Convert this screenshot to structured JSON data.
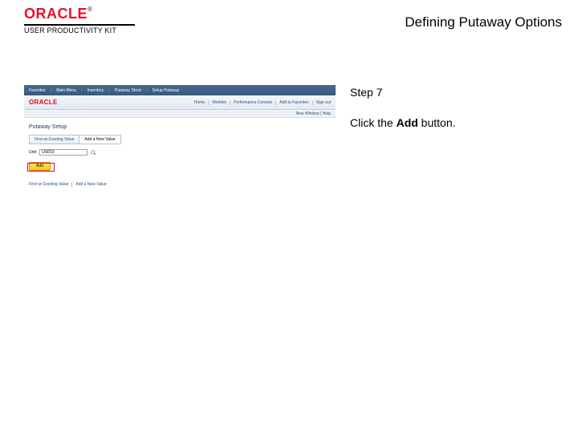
{
  "header": {
    "brand": "ORACLE",
    "brand_suffix": "®",
    "subtitle": "USER PRODUCTIVITY KIT",
    "slide_title": "Defining Putaway Options"
  },
  "instruction": {
    "step_label": "Step 7",
    "text_before": "Click the ",
    "bold": "Add",
    "text_after": " button."
  },
  "app": {
    "breadcrumb": [
      "Favorites",
      "Main Menu",
      "Inventory",
      "Putaway Stock",
      "Setup Putaway"
    ],
    "logo": "ORACLE",
    "toolbar_links": [
      "Home",
      "Worklist",
      "Performance Console",
      "Add to Favorites",
      "Sign out"
    ],
    "subbar": "New Window | Help",
    "page_title": "Putaway Setup",
    "tabs": [
      "Find an Existing Value",
      "Add a New Value"
    ],
    "field_label": "Unit:",
    "field_value": "US010",
    "add_label": "Add",
    "footer": [
      "Find an Existing Value",
      "Add a New Value"
    ]
  }
}
